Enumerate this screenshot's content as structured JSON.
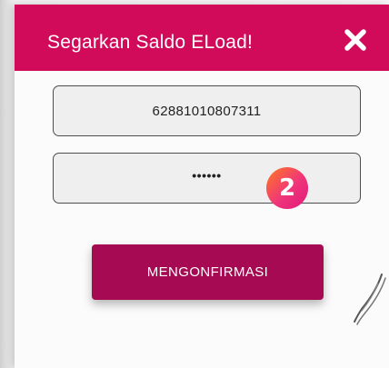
{
  "dialog": {
    "title": "Segarkan Saldo ELoad!",
    "close_icon": "close-icon",
    "header_color": "#d10b5a"
  },
  "form": {
    "phone_value": "62881010807311",
    "password_masked": "••••••"
  },
  "confirm": {
    "label": "MENGONFIRMASI",
    "color": "#a50a52"
  },
  "step_badge": {
    "label": "2"
  }
}
